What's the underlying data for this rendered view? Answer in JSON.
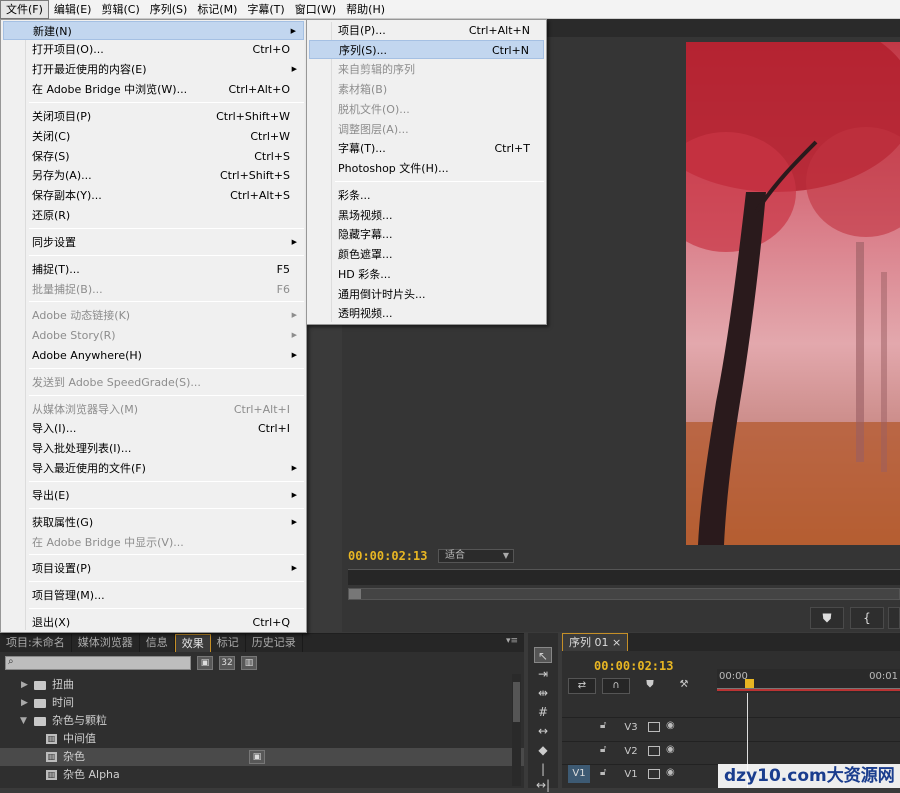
{
  "menubar": [
    "文件(F)",
    "编辑(E)",
    "剪辑(C)",
    "序列(S)",
    "标记(M)",
    "字幕(T)",
    "窗口(W)",
    "帮助(H)"
  ],
  "file_menu": [
    {
      "label": "新建(N)",
      "shortcut": "",
      "sub": true,
      "state": "hover"
    },
    {
      "label": "打开项目(O)...",
      "shortcut": "Ctrl+O"
    },
    {
      "label": "打开最近使用的内容(E)",
      "shortcut": "",
      "sub": true
    },
    {
      "label": "在 Adobe Bridge 中浏览(W)...",
      "shortcut": "Ctrl+Alt+O"
    },
    {
      "label": "关闭项目(P)",
      "shortcut": "Ctrl+Shift+W"
    },
    {
      "label": "关闭(C)",
      "shortcut": "Ctrl+W"
    },
    {
      "label": "保存(S)",
      "shortcut": "Ctrl+S"
    },
    {
      "label": "另存为(A)...",
      "shortcut": "Ctrl+Shift+S"
    },
    {
      "label": "保存副本(Y)...",
      "shortcut": "Ctrl+Alt+S"
    },
    {
      "label": "还原(R)",
      "shortcut": ""
    },
    {
      "label": "同步设置",
      "shortcut": "",
      "sub": true
    },
    {
      "label": "捕捉(T)...",
      "shortcut": "F5"
    },
    {
      "label": "批量捕捉(B)...",
      "shortcut": "F6",
      "disabled": true
    },
    {
      "label": "Adobe 动态链接(K)",
      "shortcut": "",
      "sub": true,
      "disabled": true
    },
    {
      "label": "Adobe Story(R)",
      "shortcut": "",
      "sub": true,
      "disabled": true
    },
    {
      "label": "Adobe Anywhere(H)",
      "shortcut": "",
      "sub": true
    },
    {
      "label": "发送到 Adobe SpeedGrade(S)...",
      "shortcut": "",
      "disabled": true
    },
    {
      "label": "从媒体浏览器导入(M)",
      "shortcut": "Ctrl+Alt+I",
      "disabled": true
    },
    {
      "label": "导入(I)...",
      "shortcut": "Ctrl+I"
    },
    {
      "label": "导入批处理列表(I)...",
      "shortcut": ""
    },
    {
      "label": "导入最近使用的文件(F)",
      "shortcut": "",
      "sub": true
    },
    {
      "label": "导出(E)",
      "shortcut": "",
      "sub": true
    },
    {
      "label": "获取属性(G)",
      "shortcut": "",
      "sub": true
    },
    {
      "label": "在 Adobe Bridge 中显示(V)...",
      "shortcut": "",
      "disabled": true
    },
    {
      "label": "项目设置(P)",
      "shortcut": "",
      "sub": true
    },
    {
      "label": "项目管理(M)...",
      "shortcut": ""
    },
    {
      "label": "退出(X)",
      "shortcut": "Ctrl+Q"
    }
  ],
  "new_menu": [
    {
      "label": "项目(P)...",
      "shortcut": "Ctrl+Alt+N"
    },
    {
      "label": "序列(S)...",
      "shortcut": "Ctrl+N",
      "state": "hover"
    },
    {
      "label": "来自剪辑的序列",
      "shortcut": "",
      "disabled": true
    },
    {
      "label": "素材箱(B)",
      "shortcut": "",
      "disabled": true
    },
    {
      "label": "脱机文件(O)...",
      "shortcut": "",
      "disabled": true
    },
    {
      "label": "调整图层(A)...",
      "shortcut": "",
      "disabled": true
    },
    {
      "label": "字幕(T)...",
      "shortcut": "Ctrl+T"
    },
    {
      "label": "Photoshop 文件(H)...",
      "shortcut": ""
    },
    {
      "label": "彩条...",
      "shortcut": ""
    },
    {
      "label": "黑场视频...",
      "shortcut": ""
    },
    {
      "label": "隐藏字幕...",
      "shortcut": ""
    },
    {
      "label": "颜色遮罩...",
      "shortcut": ""
    },
    {
      "label": "HD 彩条...",
      "shortcut": ""
    },
    {
      "label": "通用倒计时片头...",
      "shortcut": ""
    },
    {
      "label": "透明视频...",
      "shortcut": ""
    }
  ],
  "monitor": {
    "timecode": "00:00:02:13",
    "fit": "适合"
  },
  "project_panel": {
    "tabs": [
      "项目:未命名",
      "媒体浏览器",
      "信息",
      "效果",
      "标记",
      "历史记录"
    ],
    "selected_tab": "效果",
    "tree": [
      {
        "label": "扭曲",
        "type": "folder",
        "depth": 1
      },
      {
        "label": "时间",
        "type": "folder",
        "depth": 1
      },
      {
        "label": "杂色与颗粒",
        "type": "folder",
        "depth": 1,
        "open": true
      },
      {
        "label": "中间值",
        "type": "effect",
        "depth": 2
      },
      {
        "label": "杂色",
        "type": "effect",
        "depth": 2
      },
      {
        "label": "杂色 Alpha",
        "type": "effect",
        "depth": 2
      }
    ]
  },
  "timeline": {
    "tab": "序列 01",
    "timecode": "00:00:02:13",
    "ruler": [
      "00:00",
      "00:01"
    ],
    "tracks": [
      "V3",
      "V2",
      "V1"
    ],
    "source_track": "V1"
  },
  "watermark": "dzy10.com大资源网",
  "colors": {
    "timecode": "#e8b623",
    "menu_hover": "#c2d6ef",
    "accent_tab": "#c58f27"
  }
}
